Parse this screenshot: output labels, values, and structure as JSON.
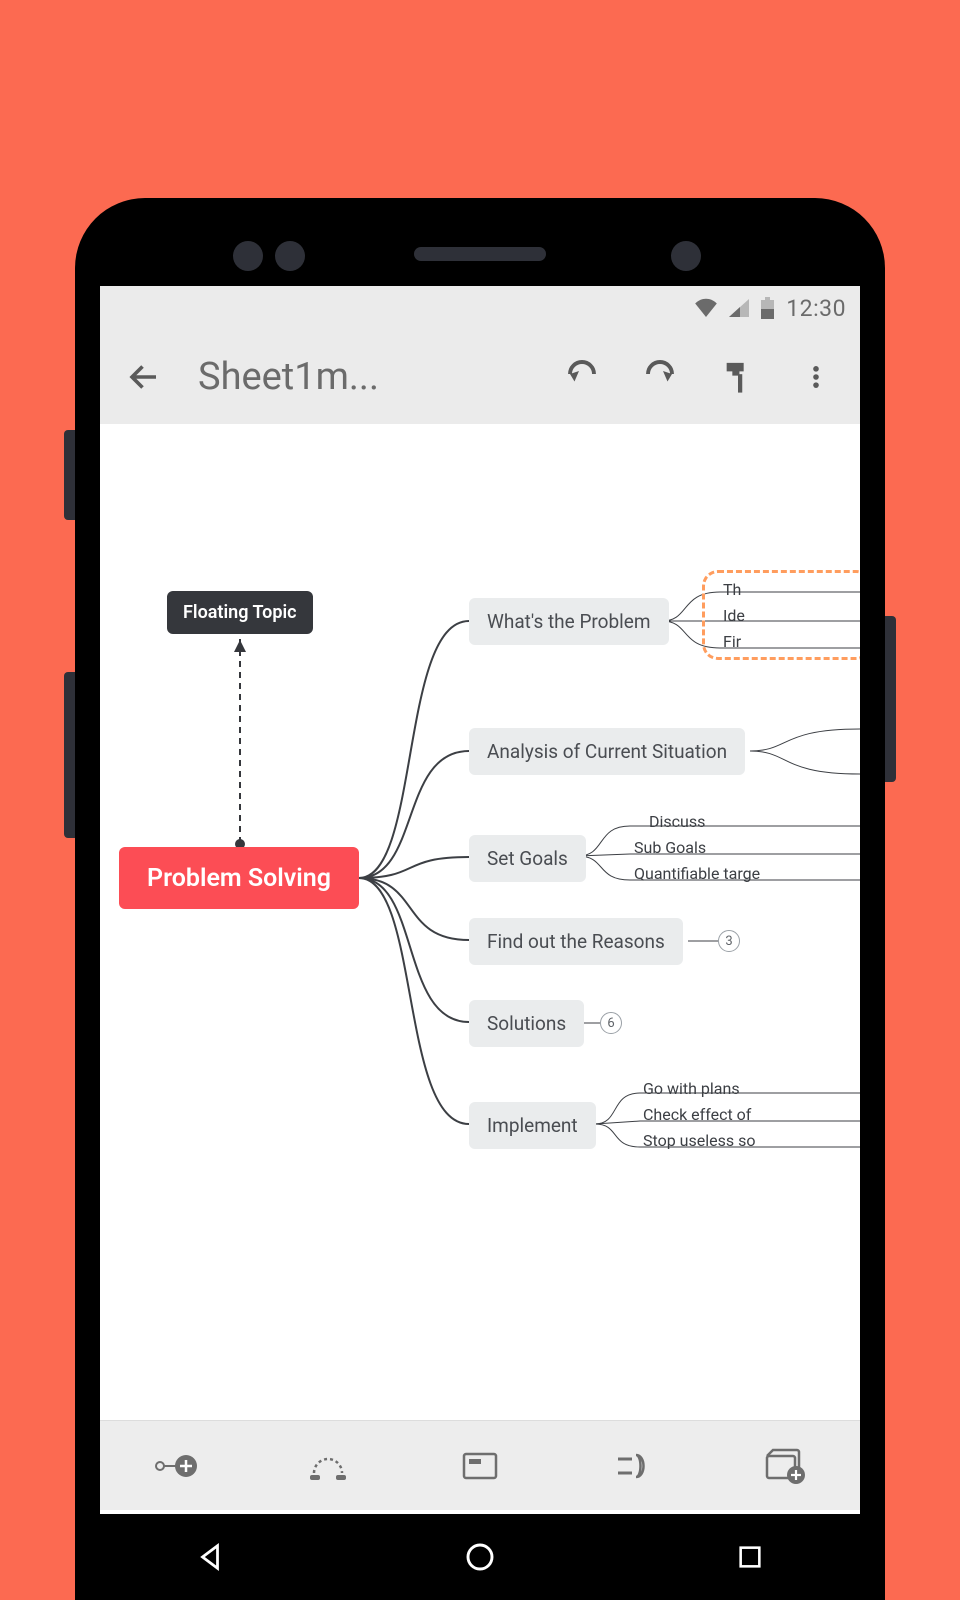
{
  "status": {
    "time": "12:30"
  },
  "toolbar": {
    "title": "Sheet1m..."
  },
  "mindmap": {
    "central": "Problem Solving",
    "floating": "Floating Topic",
    "branches": [
      {
        "label": "What's the Problem"
      },
      {
        "label": "Analysis of Current Situation"
      },
      {
        "label": "Set Goals"
      },
      {
        "label": "Find out the Reasons",
        "count": "3"
      },
      {
        "label": "Solutions",
        "count": "6"
      },
      {
        "label": "Implement"
      }
    ],
    "sub_problem": {
      "a": "Th",
      "b": "Ide",
      "c": "Fir"
    },
    "sub_goals": {
      "a": "Discuss",
      "b": "Sub Goals",
      "c": "Quantifiable targe"
    },
    "sub_implement": {
      "a": "Go with plans",
      "b": "Check effect of",
      "c": "Stop useless so"
    }
  }
}
